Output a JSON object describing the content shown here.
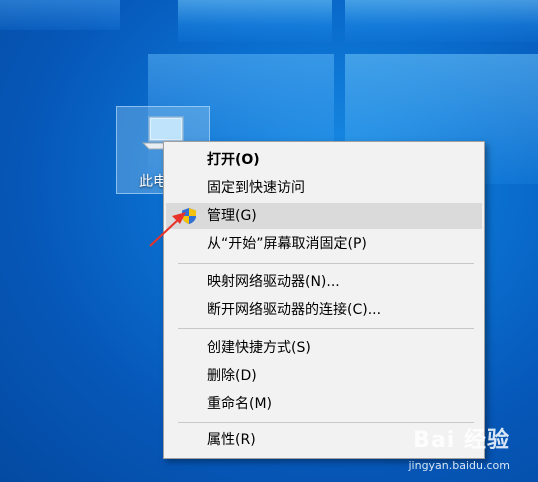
{
  "desktop": {
    "icon_label": "此电"
  },
  "context_menu": {
    "items": [
      {
        "label": "打开(O)"
      },
      {
        "label": "固定到快速访问"
      },
      {
        "label": "管理(G)"
      },
      {
        "label": "从“开始”屏幕取消固定(P)"
      },
      {
        "label": "映射网络驱动器(N)..."
      },
      {
        "label": "断开网络驱动器的连接(C)..."
      },
      {
        "label": "创建快捷方式(S)"
      },
      {
        "label": "删除(D)"
      },
      {
        "label": "重命名(M)"
      },
      {
        "label": "属性(R)"
      }
    ],
    "highlighted_item": "管理(G)"
  },
  "annotation": {
    "arrow_color": "#e8322a"
  },
  "watermark": {
    "brand": "Bai 经验",
    "url": "jingyan.baidu.com"
  },
  "colors": {
    "menu_bg": "#f2f2f2",
    "hover_bg": "#dadada",
    "desktop_blue": "#0a6fcf"
  }
}
